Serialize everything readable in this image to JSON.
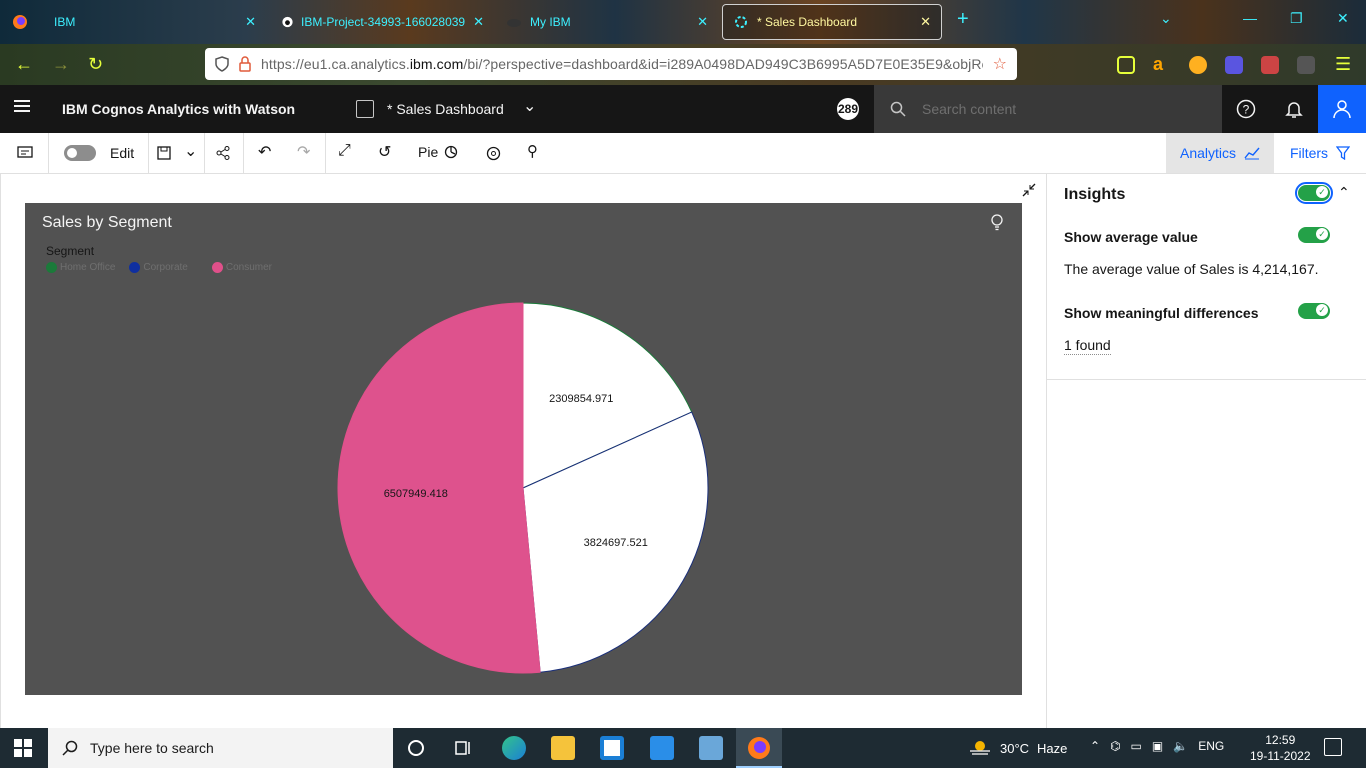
{
  "browser": {
    "tabs": [
      {
        "label": "IBM"
      },
      {
        "label": "IBM-Project-34993-166028039"
      },
      {
        "label": "My IBM"
      },
      {
        "label": "* Sales Dashboard"
      }
    ],
    "url_prefix": "https://eu1.ca.analytics.",
    "url_domain": "ibm.com",
    "url_suffix": "/bi/?perspective=dashboard&id=i289A0498DAD949C3B6995A5D7E0E35E9&objRef="
  },
  "header": {
    "app_title": "IBM Cognos Analytics with Watson",
    "dashboard_title": "* Sales Dashboard",
    "badge": "289",
    "search_placeholder": "Search content"
  },
  "toolbar": {
    "edit_label": "Edit",
    "viz_type": "Pie",
    "analytics_label": "Analytics",
    "filters_label": "Filters"
  },
  "widget": {
    "title": "Sales by Segment",
    "legend_title": "Segment"
  },
  "chart_data": {
    "type": "pie",
    "categories": [
      "Home Office",
      "Corporate",
      "Consumer"
    ],
    "values": [
      2309854.971,
      3824697.521,
      6507949.418
    ],
    "labels": [
      "2309854.971",
      "3824697.521",
      "6507949.418"
    ],
    "colors": [
      "#ffffff",
      "#ffffff",
      "#de528d"
    ],
    "legend_colors": [
      "#1b7a3a",
      "#0f2fa0",
      "#e0508a"
    ],
    "slice_stroke": [
      "#1b7a3a",
      "#1a2f7a",
      "#e0508a"
    ]
  },
  "insights": {
    "title": "Insights",
    "avg_label": "Show average value",
    "avg_text": "The average value of Sales is 4,214,167.",
    "diff_label": "Show meaningful differences",
    "diff_found": "1 found"
  },
  "taskbar": {
    "search_placeholder": "Type here to search",
    "weather_temp": "30°C",
    "weather_desc": "Haze",
    "lang": "ENG",
    "time": "12:59",
    "date": "19-11-2022"
  }
}
